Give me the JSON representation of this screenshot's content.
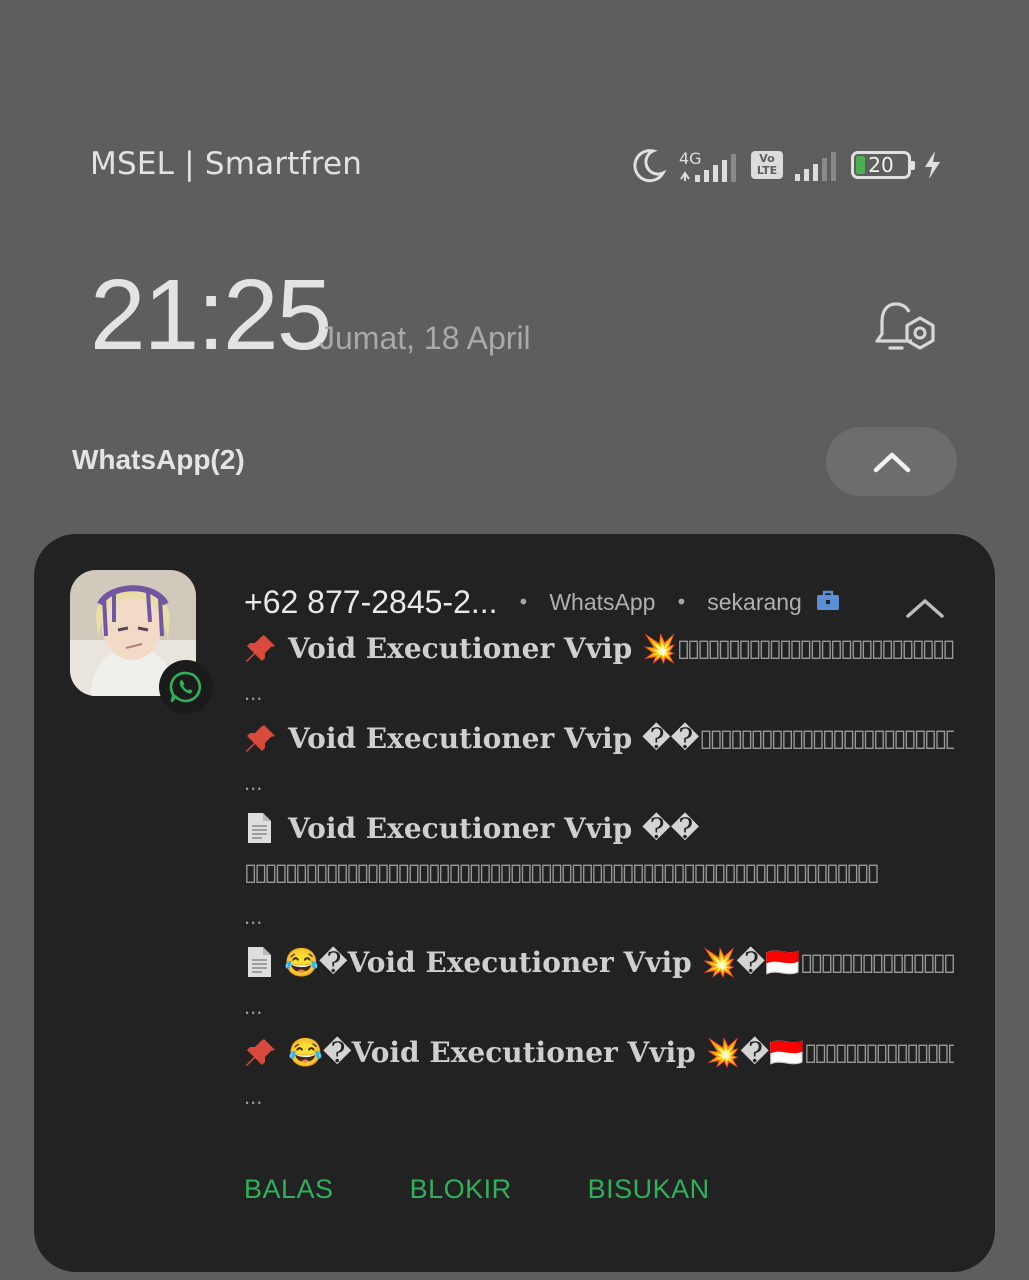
{
  "status_bar": {
    "carrier": "MSEL | Smartfren",
    "network_type": "4G",
    "volte_label": "Vo LTE",
    "battery_level": "20",
    "battery_color": "#4caf50",
    "icons": [
      "moon-icon",
      "signal-icon",
      "volte-icon",
      "signal-icon",
      "battery-icon",
      "charging-icon"
    ]
  },
  "lockscreen": {
    "time": "21:25",
    "date": "Jumat, 18 April"
  },
  "group": {
    "title": "WhatsApp(2)"
  },
  "notification": {
    "sender": "+62 877-2845-2...",
    "app": "WhatsApp",
    "time": "sekarang",
    "accent_color": "#2fb15b",
    "messages": [
      {
        "icon": "pin-icon",
        "prefix": "",
        "text": "Void Executioner Vvip",
        "suffix": "💥",
        "tail": "▯▯▯▯▯▯▯▯▯▯▯▯▯▯▯▯▯▯▯▯▯▯▯▯▯▯▯▯▯▯▯▯▯▯▯▯▯▯▯",
        "ellipsis": "..."
      },
      {
        "icon": "pin-icon",
        "prefix": "",
        "text": "Void Executioner Vvip",
        "suffix": "��",
        "tail": "▯▯▯▯▯▯▯▯▯▯▯▯▯▯▯▯▯▯▯▯▯▯▯▯▯▯▯▯▯▯▯▯▯▯▯▯",
        "ellipsis": "..."
      },
      {
        "icon": "document-icon",
        "prefix": "",
        "text": "Void Executioner Vvip",
        "suffix": "��",
        "tail": "▯▯▯▯▯▯▯▯▯▯▯▯▯▯▯▯▯▯▯▯▯▯▯▯▯▯▯▯▯▯▯▯▯▯▯▯▯▯▯▯▯▯▯▯▯▯▯▯▯▯▯▯▯▯▯▯▯▯▯▯▯▯",
        "ellipsis": "..."
      },
      {
        "icon": "document-icon",
        "prefix": "😂�",
        "text": "Void Executioner Vvip",
        "suffix": "💥�🇮🇩",
        "tail": "▯▯▯▯▯▯▯▯▯▯▯▯▯▯▯▯▯▯▯▯▯▯▯▯▯▯▯▯",
        "ellipsis": "..."
      },
      {
        "icon": "pin-icon",
        "prefix": "😂�",
        "text": "Void Executioner Vvip",
        "suffix": "💥�🇮🇩",
        "tail": "▯▯▯▯▯▯▯▯▯▯▯▯▯▯▯▯▯▯▯▯▯▯▯▯▯▯▯▯",
        "ellipsis": "..."
      }
    ],
    "actions": [
      "BALAS",
      "BLOKIR",
      "BISUKAN"
    ]
  }
}
